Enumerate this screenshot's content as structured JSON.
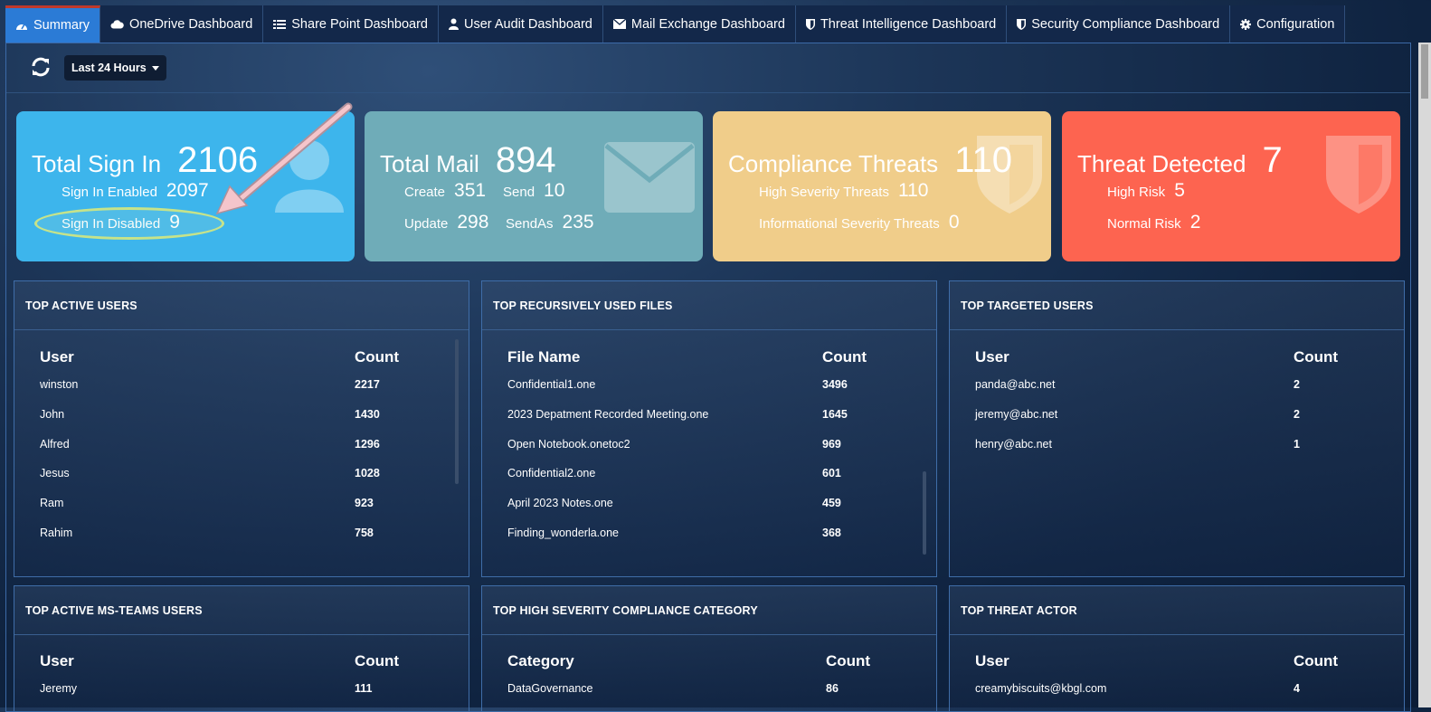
{
  "tabs": [
    {
      "label": "Summary",
      "icon": "dashboard-icon",
      "active": true
    },
    {
      "label": "OneDrive Dashboard",
      "icon": "cloud-icon"
    },
    {
      "label": "Share Point Dashboard",
      "icon": "list-icon"
    },
    {
      "label": "User Audit Dashboard",
      "icon": "user-icon"
    },
    {
      "label": "Mail Exchange Dashboard",
      "icon": "envelope-icon"
    },
    {
      "label": "Threat Intelligence Dashboard",
      "icon": "shield-icon"
    },
    {
      "label": "Security Compliance Dashboard",
      "icon": "shield-icon"
    },
    {
      "label": "Configuration",
      "icon": "gear-icon"
    }
  ],
  "toolbar": {
    "range_label": "Last 24 Hours"
  },
  "cards": {
    "signin": {
      "title": "Total Sign In",
      "total": "2106",
      "enabled_label": "Sign In Enabled",
      "enabled": "2097",
      "disabled_label": "Sign In Disabled",
      "disabled": "9",
      "color": "#3db5ec"
    },
    "mail": {
      "title": "Total Mail",
      "total": "894",
      "create_label": "Create",
      "create": "351",
      "send_label": "Send",
      "send": "10",
      "update_label": "Update",
      "update": "298",
      "sendas_label": "SendAs",
      "sendas": "235",
      "color": "#6facb8"
    },
    "compliance": {
      "title": "Compliance Threats",
      "total": "110",
      "high_label": "High Severity Threats",
      "high": "110",
      "info_label": "Informational Severity Threats",
      "info": "0",
      "color": "#f0cd8a"
    },
    "threat": {
      "title": "Threat Detected",
      "total": "7",
      "high_label": "High Risk",
      "high": "5",
      "normal_label": "Normal Risk",
      "normal": "2",
      "color": "#fd6450"
    }
  },
  "panels": {
    "active_users": {
      "title": "TOP ACTIVE USERS",
      "col1": "User",
      "col2": "Count",
      "rows": [
        [
          "winston",
          "2217"
        ],
        [
          "John",
          "1430"
        ],
        [
          "Alfred",
          "1296"
        ],
        [
          "Jesus",
          "1028"
        ],
        [
          "Ram",
          "923"
        ],
        [
          "Rahim",
          "758"
        ]
      ]
    },
    "files": {
      "title": "TOP RECURSIVELY USED FILES",
      "col1": "File Name",
      "col2": "Count",
      "rows": [
        [
          "Confidential1.one",
          "3496"
        ],
        [
          "2023 Depatment Recorded Meeting.one",
          "1645"
        ],
        [
          "Open Notebook.onetoc2",
          "969"
        ],
        [
          "Confidential2.one",
          "601"
        ],
        [
          "April 2023 Notes.one",
          "459"
        ],
        [
          "Finding_wonderla.one",
          "368"
        ]
      ]
    },
    "targeted": {
      "title": "TOP TARGETED USERS",
      "col1": "User",
      "col2": "Count",
      "rows": [
        [
          "panda@abc.net",
          "2"
        ],
        [
          "jeremy@abc.net",
          "2"
        ],
        [
          "henry@abc.net",
          "1"
        ]
      ]
    },
    "teams": {
      "title": "TOP ACTIVE MS-TEAMS USERS",
      "col1": "User",
      "col2": "Count",
      "rows": [
        [
          "Jeremy",
          "111"
        ]
      ]
    },
    "compliance_cat": {
      "title": "TOP HIGH SEVERITY COMPLIANCE CATEGORY",
      "col1": "Category",
      "col2": "Count",
      "rows": [
        [
          "DataGovernance",
          "86"
        ]
      ]
    },
    "threat_actor": {
      "title": "TOP THREAT ACTOR",
      "col1": "User",
      "col2": "Count",
      "rows": [
        [
          "creamybiscuits@kbgl.com",
          "4"
        ]
      ]
    }
  }
}
